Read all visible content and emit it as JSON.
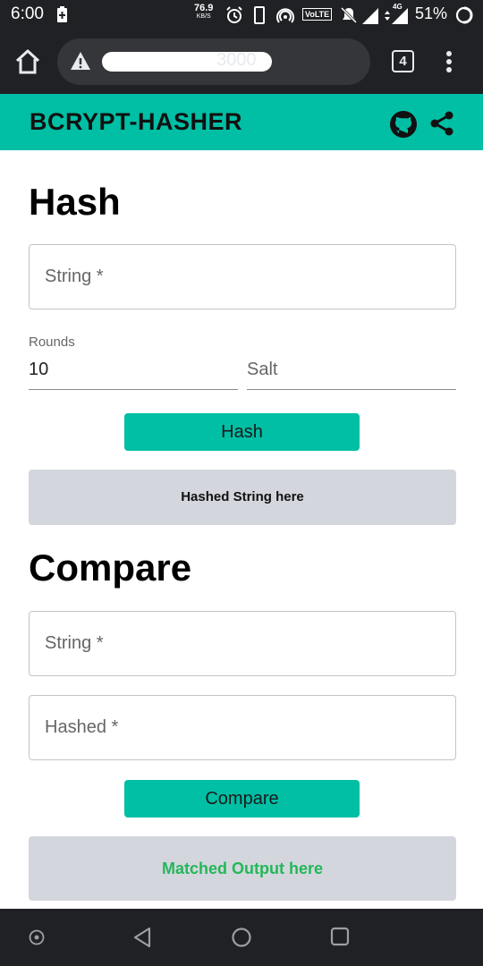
{
  "status_bar": {
    "time": "6:00",
    "net_speed_value": "76.9",
    "net_speed_unit": "KB/S",
    "volte": "VoLTE",
    "network": "4G",
    "battery": "51%"
  },
  "browser": {
    "url_suffix": "3000",
    "tab_count": "4"
  },
  "app": {
    "title": "BCRYPT-HASHER",
    "accent_color": "#00bfa5"
  },
  "hash_section": {
    "title": "Hash",
    "string_placeholder": "String *",
    "rounds_label": "Rounds",
    "rounds_value": "10",
    "salt_placeholder": "Salt",
    "button_label": "Hash",
    "output_text": "Hashed String here"
  },
  "compare_section": {
    "title": "Compare",
    "string_placeholder": "String *",
    "hashed_placeholder": "Hashed *",
    "button_label": "Compare",
    "output_text": "Matched Output here",
    "output_color": "#22b85a"
  },
  "icons": {
    "header": [
      "github-icon",
      "share-icon"
    ],
    "nav": [
      "assistant-icon",
      "back-icon",
      "home-icon",
      "recents-icon"
    ]
  }
}
